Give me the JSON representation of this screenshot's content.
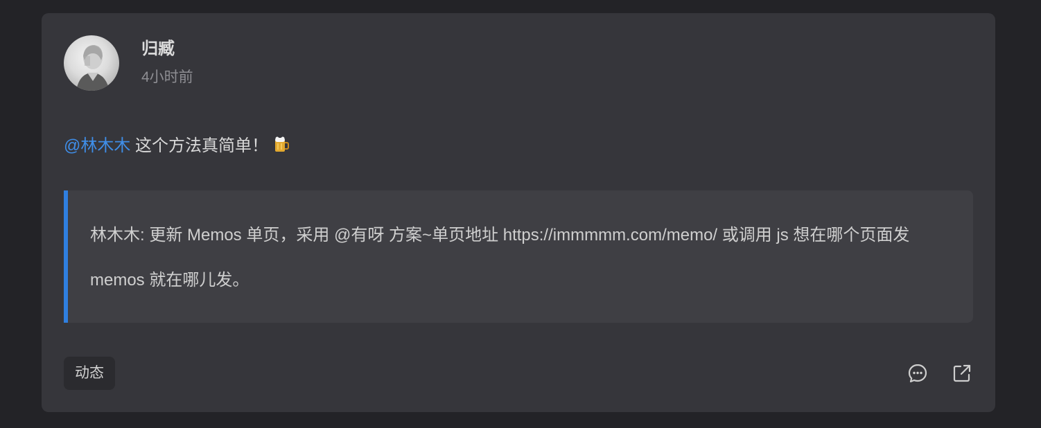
{
  "post": {
    "author": "归臧",
    "time": "4小时前",
    "mention": "@林木木",
    "text": " 这个方法真简单！",
    "emoji_icon": "beer-mug-icon",
    "quote": "林木木: 更新 Memos 单页，采用 @有呀 方案~单页地址 https://immmmm.com/memo/ 或调用 js 想在哪个页面发 memos 就在哪儿发。",
    "tag": "动态"
  },
  "actions": [
    {
      "icon": "comment-icon"
    },
    {
      "icon": "external-link-icon"
    }
  ],
  "colors": {
    "background": "#232327",
    "card": "#36363b",
    "quote_bg": "#3f3f44",
    "accent": "#2f7fe0",
    "mention": "#3f8ee8"
  }
}
